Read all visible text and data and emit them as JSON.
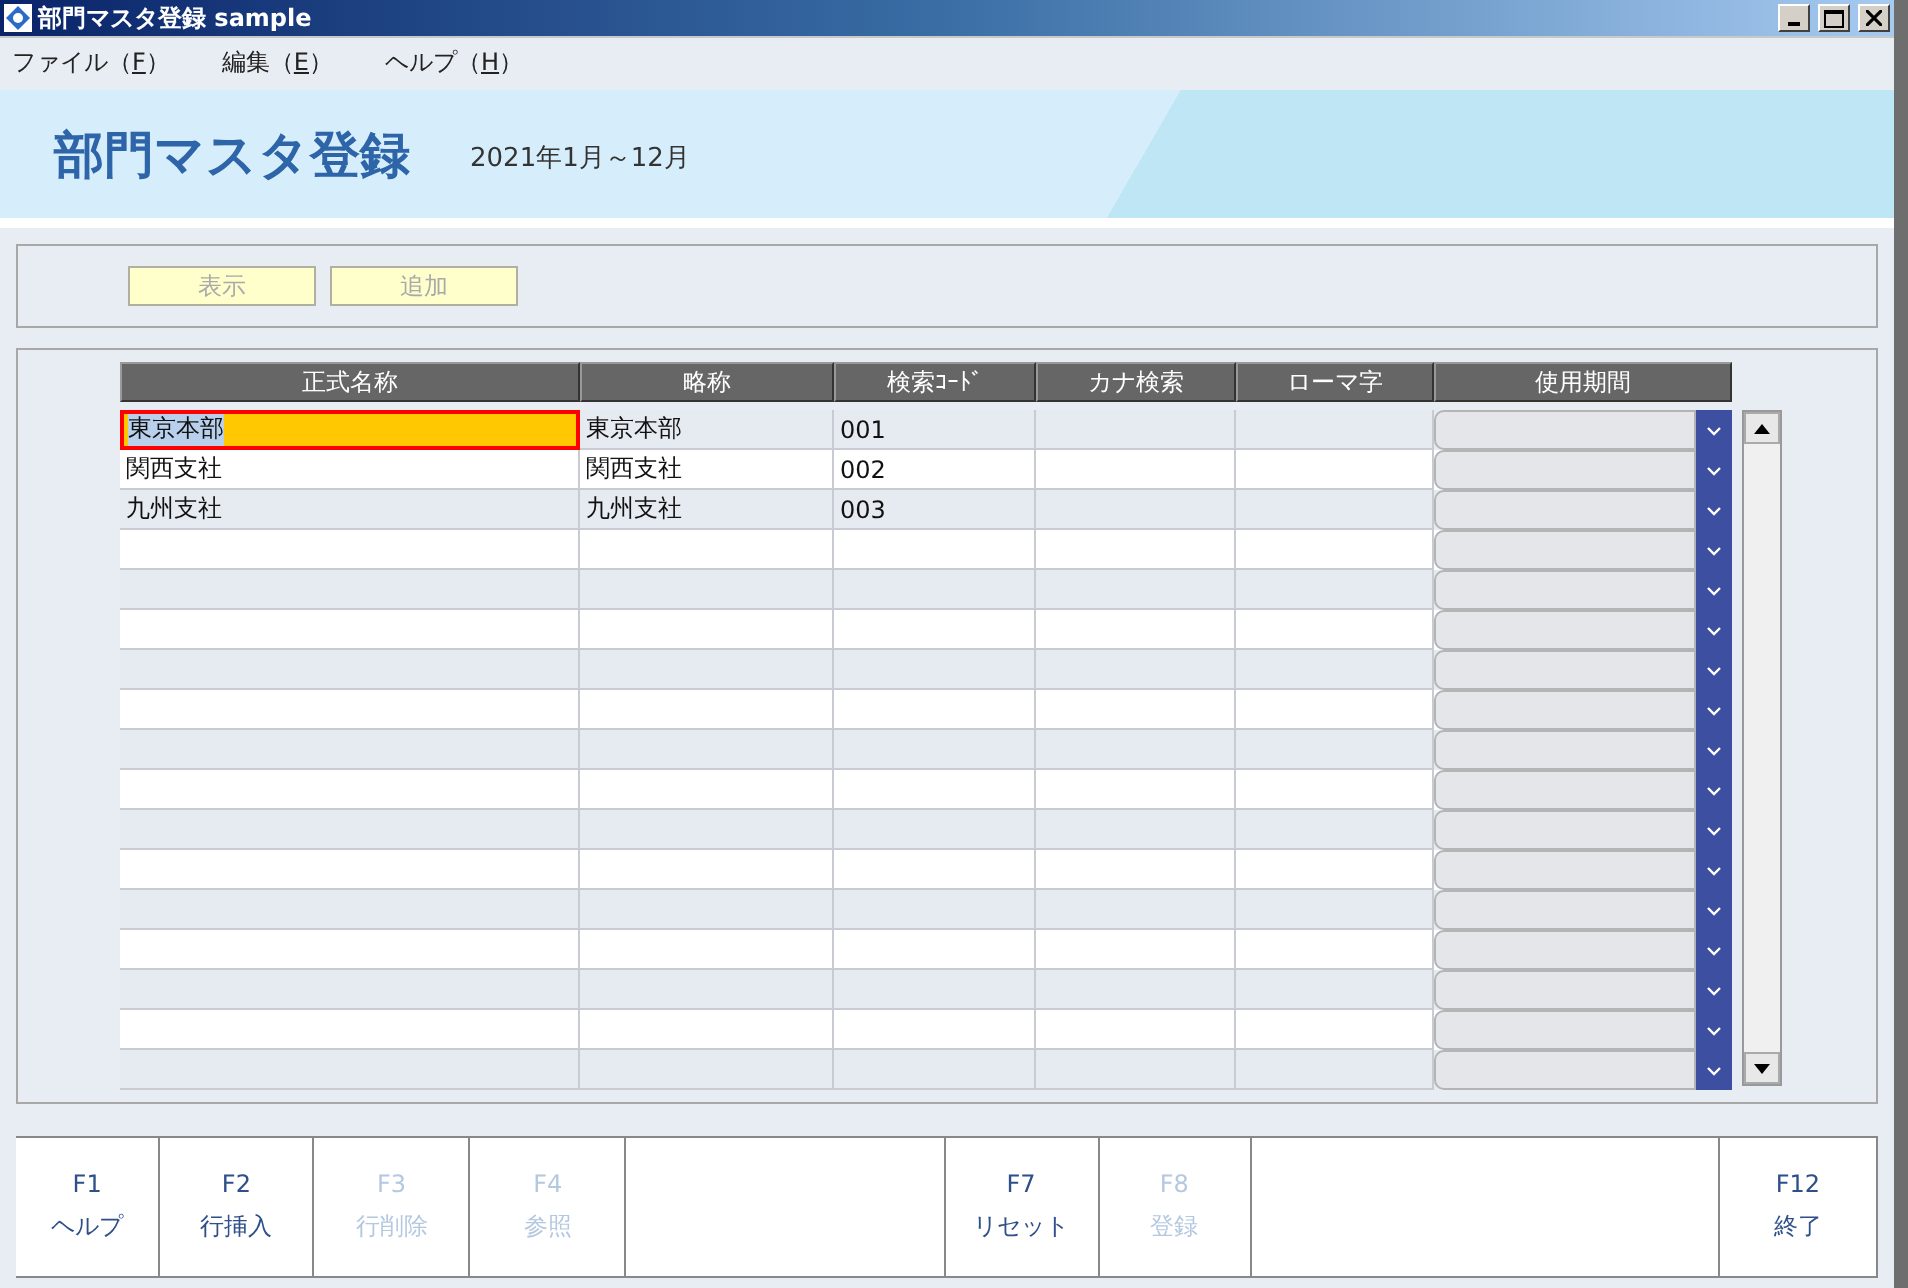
{
  "window": {
    "title": "部門マスタ登録 sample"
  },
  "menu": [
    {
      "label": "ファイル（",
      "key": "F",
      "suffix": "）"
    },
    {
      "label": "編集（",
      "key": "E",
      "suffix": "）"
    },
    {
      "label": "ヘルプ（",
      "key": "H",
      "suffix": "）"
    }
  ],
  "header": {
    "title": "部門マスタ登録",
    "period": "2021年1月～12月"
  },
  "toolbar": [
    {
      "label": "表示",
      "disabled": true
    },
    {
      "label": "追加",
      "disabled": true
    }
  ],
  "table": {
    "columns": [
      "正式名称",
      "略称",
      "検索ｺｰﾄﾞ",
      "カナ検索",
      "ローマ字",
      "使用期間"
    ],
    "rows": [
      {
        "cells": [
          "東京本部",
          "東京本部",
          "001"
        ],
        "selected": true
      },
      {
        "cells": [
          "関西支社",
          "関西支社",
          "002"
        ],
        "selected": false
      },
      {
        "cells": [
          "九州支社",
          "九州支社",
          "003"
        ],
        "selected": false
      }
    ]
  },
  "function_keys": [
    {
      "kind": "key",
      "key": "F1",
      "label": "ヘルプ",
      "disabled": false
    },
    {
      "kind": "key",
      "key": "F2",
      "label": "行挿入",
      "disabled": false
    },
    {
      "kind": "key",
      "key": "F3",
      "label": "行削除",
      "disabled": true
    },
    {
      "kind": "key",
      "key": "F4",
      "label": "参照",
      "disabled": true
    },
    {
      "kind": "blank"
    },
    {
      "kind": "key",
      "key": "F7",
      "label": "リセット",
      "disabled": false
    },
    {
      "kind": "key",
      "key": "F8",
      "label": "登録",
      "disabled": true
    },
    {
      "kind": "blank"
    },
    {
      "kind": "key",
      "key": "F12",
      "label": "終了",
      "disabled": false
    }
  ]
}
